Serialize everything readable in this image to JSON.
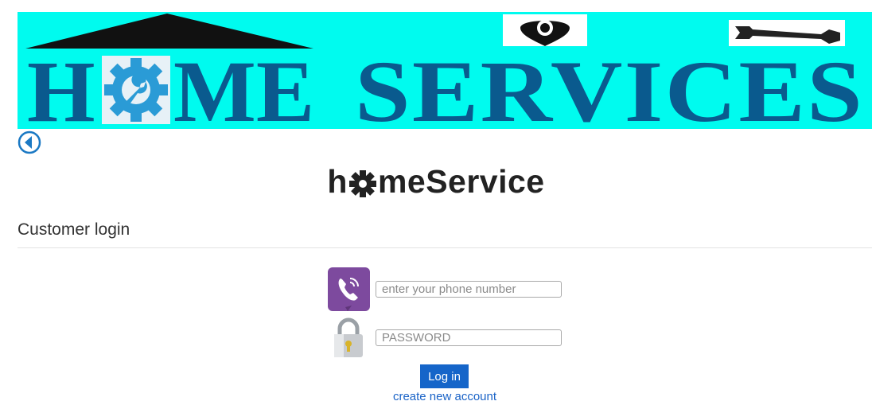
{
  "banner": {
    "text_part1": "H",
    "text_part2": "ME",
    "text_part3": "SERVICES",
    "bg_color": "#00fbef",
    "text_color": "#0a5a8e"
  },
  "nav": {
    "back_icon": "circle-chevron-left-icon"
  },
  "site_title": {
    "part1": "h",
    "part2": "meService"
  },
  "login": {
    "heading": "Customer login",
    "phone_placeholder": "enter your phone number",
    "password_placeholder": "PASSWORD",
    "login_label": "Log in",
    "create_account_label": "create new account"
  },
  "colors": {
    "accent": "#1565c9",
    "link": "#1a63c7"
  }
}
